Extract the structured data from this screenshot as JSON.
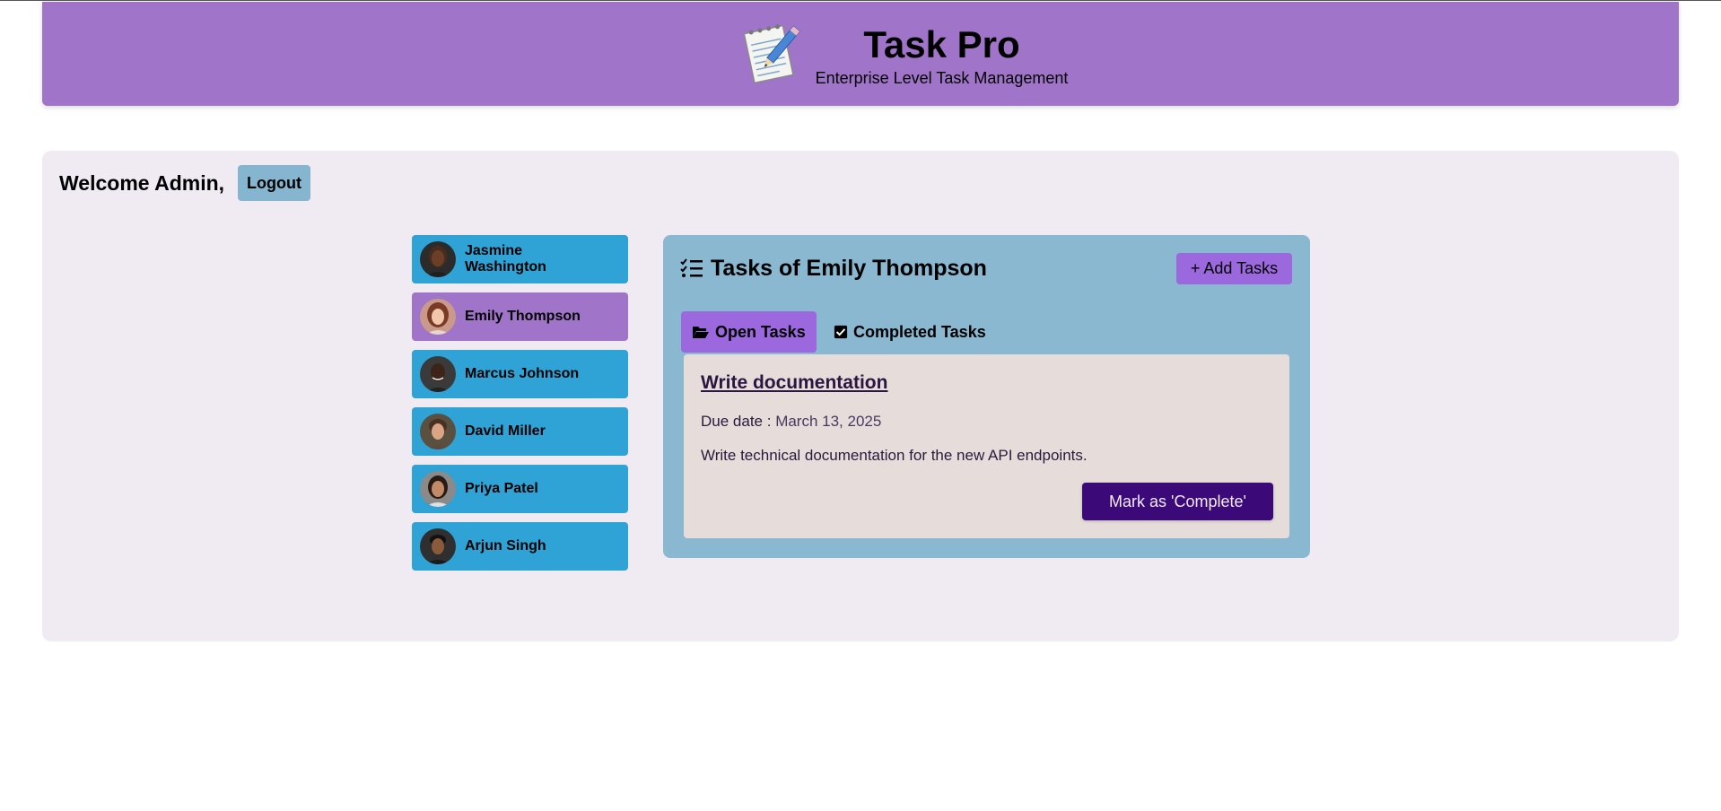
{
  "header": {
    "title": "Task Pro",
    "subtitle": "Enterprise Level Task Management",
    "logo_icon": "notepad-pencil-icon"
  },
  "session": {
    "welcome": "Welcome Admin,",
    "logout_label": "Logout"
  },
  "users": [
    {
      "name": "Jasmine Washington",
      "active": false
    },
    {
      "name": "Emily Thompson",
      "active": true
    },
    {
      "name": "Marcus Johnson",
      "active": false
    },
    {
      "name": "David Miller",
      "active": false
    },
    {
      "name": "Priya Patel",
      "active": false
    },
    {
      "name": "Arjun Singh",
      "active": false
    }
  ],
  "tasks_panel": {
    "title": "Tasks of Emily Thompson",
    "add_label": "+ Add Tasks",
    "tabs": [
      {
        "label": "Open Tasks",
        "icon": "folder-open-icon",
        "active": true
      },
      {
        "label": "Completed Tasks",
        "icon": "checkbox-icon",
        "active": false
      }
    ],
    "task": {
      "title": "Write documentation",
      "due_label": "Due date :",
      "due_value": "March 13, 2025",
      "description": "Write technical documentation for the new API endpoints.",
      "complete_label": "Mark as 'Complete'"
    }
  },
  "colors": {
    "header_bg": "#a074c8",
    "user_item": "#2fa3d5",
    "user_item_active": "#a074c8",
    "panel_bg": "#8ab8d1",
    "accent_button": "#9b68de",
    "complete_button": "#3b0a78"
  }
}
